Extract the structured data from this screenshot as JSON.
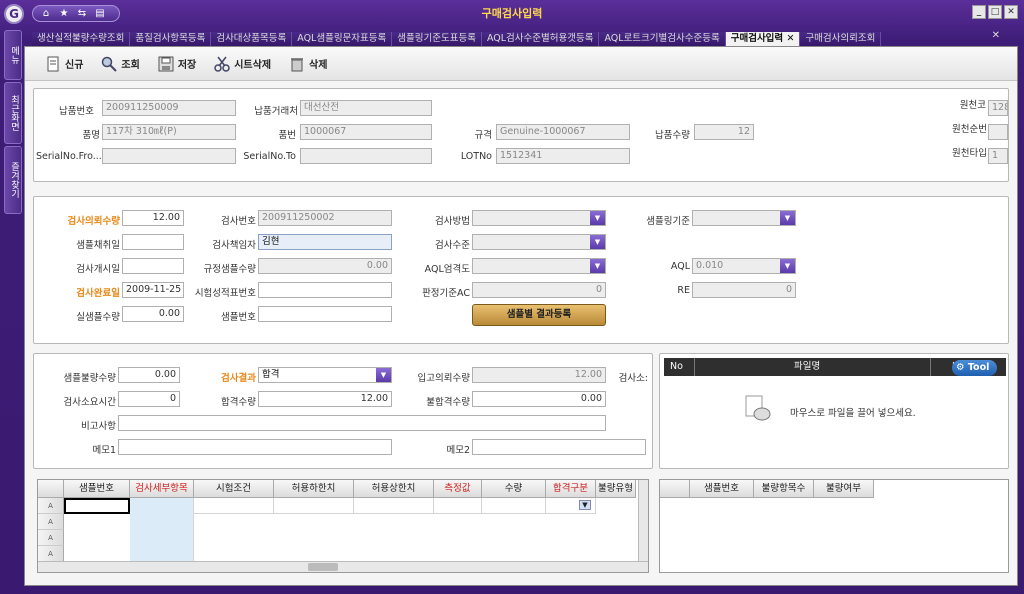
{
  "window": {
    "title": "구매검사입력"
  },
  "logo": {
    "glyph": "G"
  },
  "quick": [
    "⌂",
    "★",
    "⇆",
    "▤"
  ],
  "tabs": [
    "생산실적불량수량조회",
    "품질검사항목등록",
    "검사대상품목등록",
    "AQL샘플링문자표등록",
    "샘플링기준도표등록",
    "AQL검사수준별허용갯등록",
    "AQL로트크기별검사수준등록",
    "구매검사입력 ✕",
    "구매검사의뢰조회"
  ],
  "sidebar": [
    "메뉴",
    "최근화면",
    "즐겨찾기"
  ],
  "toolbar": {
    "new": "신규",
    "search": "조회",
    "save": "저장",
    "sheet_delete": "시트삭제",
    "delete": "삭제"
  },
  "header": {
    "delivery_no_label": "납품번호",
    "delivery_no": "200911250009",
    "vendor_label": "납품거래처",
    "vendor": "대선산전",
    "item_name_label": "품명",
    "item_name": "117차 310㎖(P)",
    "item_no_label": "품번",
    "item_no": "1000067",
    "spec_label": "규격",
    "spec": "Genuine-1000067",
    "qty_label": "납품수량",
    "qty": "12",
    "serial_from_label": "SerialNo.Fro...",
    "serial_from": "",
    "serial_to_label": "SerialNo.To",
    "serial_to": "",
    "lot_label": "LOTNo",
    "lot": "1512341",
    "r1_label": "원천코",
    "r1": "128",
    "r2_label": "원천순번",
    "r2": "",
    "r3_label": "원천타입",
    "r3": "1"
  },
  "inspect": {
    "req_qty_label": "검사의뢰수량",
    "req_qty": "12.00",
    "insp_no_label": "검사번호",
    "insp_no": "200911250002",
    "method_label": "검사방법",
    "method": "",
    "sampling_std_label": "샘플링기준",
    "sampling_std": "",
    "sample_date_label": "샘플채취일",
    "sample_date": "",
    "inspector_label": "검사책임자",
    "inspector": "김현",
    "level_label": "검사수준",
    "level": "",
    "start_label": "검사개시일",
    "start": "",
    "std_sample_label": "규정샘플수량",
    "std_sample": "0.00",
    "aql_strict_label": "AQL엄격도",
    "aql_strict": "",
    "aql_label": "AQL",
    "aql": "0.010",
    "done_label": "검사완료일",
    "done": "2009-11-25",
    "report_no_label": "시험성적표번호",
    "report_no": "",
    "ac_label": "판정기준AC",
    "ac": "0",
    "re_label": "RE",
    "re": "0",
    "real_sample_label": "실샘플수량",
    "real_sample": "0.00",
    "sample_no_label": "샘플번호",
    "sample_no": "",
    "result_button": "샘플별 결과등록"
  },
  "result": {
    "defect_qty_label": "샘플불량수량",
    "defect_qty": "0.00",
    "result_label": "검사결과",
    "result": "합격",
    "in_req_label": "입고의뢰수량",
    "in_req": "12.00",
    "inspector2_label": "검사소:",
    "time_label": "검사소요시간",
    "time": "0",
    "pass_label": "합격수량",
    "pass": "12.00",
    "fail_label": "불합격수량",
    "fail": "0.00",
    "remark_label": "비고사항",
    "remark": "",
    "memo1_label": "메모1",
    "memo1": "",
    "memo2_label": "메모2",
    "memo2": ""
  },
  "files": {
    "no": "No",
    "name": "파일명",
    "col3": "I",
    "tool": "Tool",
    "drop": "마우스로 파일을 끌어 넣으세요."
  },
  "grid": {
    "columns": [
      "샘플번호",
      "검사세부항목",
      "시험조건",
      "허용하한치",
      "허용상한치",
      "측정값",
      "수량",
      "합격구분",
      "불량유형"
    ],
    "row_marker": "A"
  },
  "grid2": {
    "columns": [
      "샘플번호",
      "불량항목수",
      "불량여부"
    ]
  }
}
